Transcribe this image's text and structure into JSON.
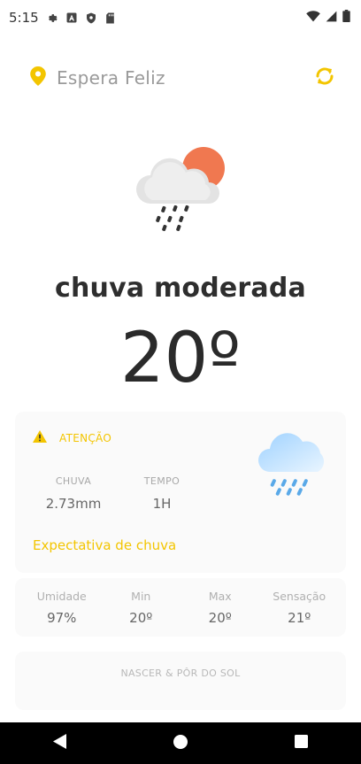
{
  "status_bar": {
    "time": "5:15",
    "icons": [
      "gear-icon",
      "font-a-icon",
      "shield-icon",
      "sd-card-icon",
      "wifi-icon",
      "signal-icon",
      "battery-icon"
    ]
  },
  "location": {
    "city": "Espera Feliz",
    "pin_icon": "location-pin-icon",
    "refresh_icon": "refresh-icon"
  },
  "current": {
    "condition": "chuva moderada",
    "temperature": "20º",
    "illustration": "cloud-sun-rain-icon"
  },
  "alert": {
    "icon": "warning-icon",
    "title": "ATENÇÃO",
    "rain_label": "CHUVA",
    "rain_value": "2.73mm",
    "time_label": "TEMPO",
    "time_value": "1H",
    "expectation": "Expectativa de chuva",
    "illustration": "rain-cloud-icon"
  },
  "stats": [
    {
      "label": "Umidade",
      "value": "97%"
    },
    {
      "label": "Min",
      "value": "20º"
    },
    {
      "label": "Max",
      "value": "20º"
    },
    {
      "label": "Sensação",
      "value": "21º"
    }
  ],
  "sun": {
    "title": "NASCER & PÔR DO SOL"
  },
  "colors": {
    "accent": "#f3c500",
    "sun": "#f07850",
    "rain": "#5aa9e8"
  },
  "nav": [
    "back-icon",
    "home-icon",
    "recents-icon"
  ]
}
